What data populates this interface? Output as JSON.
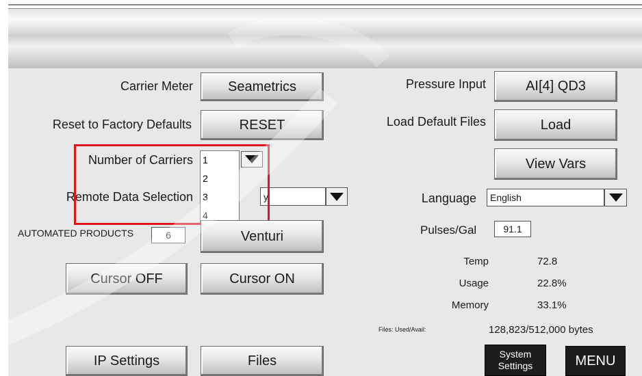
{
  "left": {
    "carrier_meter_label": "Carrier Meter",
    "carrier_meter_value": "Seametrics",
    "reset_label": "Reset to Factory Defaults",
    "reset_button": "RESET",
    "carriers_label": "Number of Carriers",
    "carriers_options": [
      "1",
      "2",
      "3",
      "4"
    ],
    "remote_label": "Remote Data Selection",
    "remote_value": "y",
    "automated_label": "AUTOMATED PRODUCTS",
    "automated_value": "6",
    "venturi_button": "Venturi",
    "cursor_off": "Cursor OFF",
    "cursor_on": "Cursor ON"
  },
  "right": {
    "pressure_label": "Pressure Input",
    "pressure_value": "AI[4]  QD3",
    "load_defaults_label": "Load Default Files",
    "load_button": "Load",
    "view_vars_button": "View Vars",
    "language_label": "Language",
    "language_value": "English",
    "pulses_label": "Pulses/Gal",
    "pulses_value": "91.1",
    "stats": [
      {
        "label": "Temp",
        "value": "72.8"
      },
      {
        "label": "Usage",
        "value": "22.8%"
      },
      {
        "label": "Memory",
        "value": "33.1%"
      }
    ],
    "files_label": "Files: Used/Avail:",
    "files_value": "128,823/512,000 bytes"
  },
  "footer": {
    "ip_settings": "IP Settings",
    "files": "Files",
    "system_settings": "System Settings",
    "menu": "MENU"
  },
  "colors": {
    "highlight": "#e0141e",
    "panel": "#e8e8e8"
  }
}
